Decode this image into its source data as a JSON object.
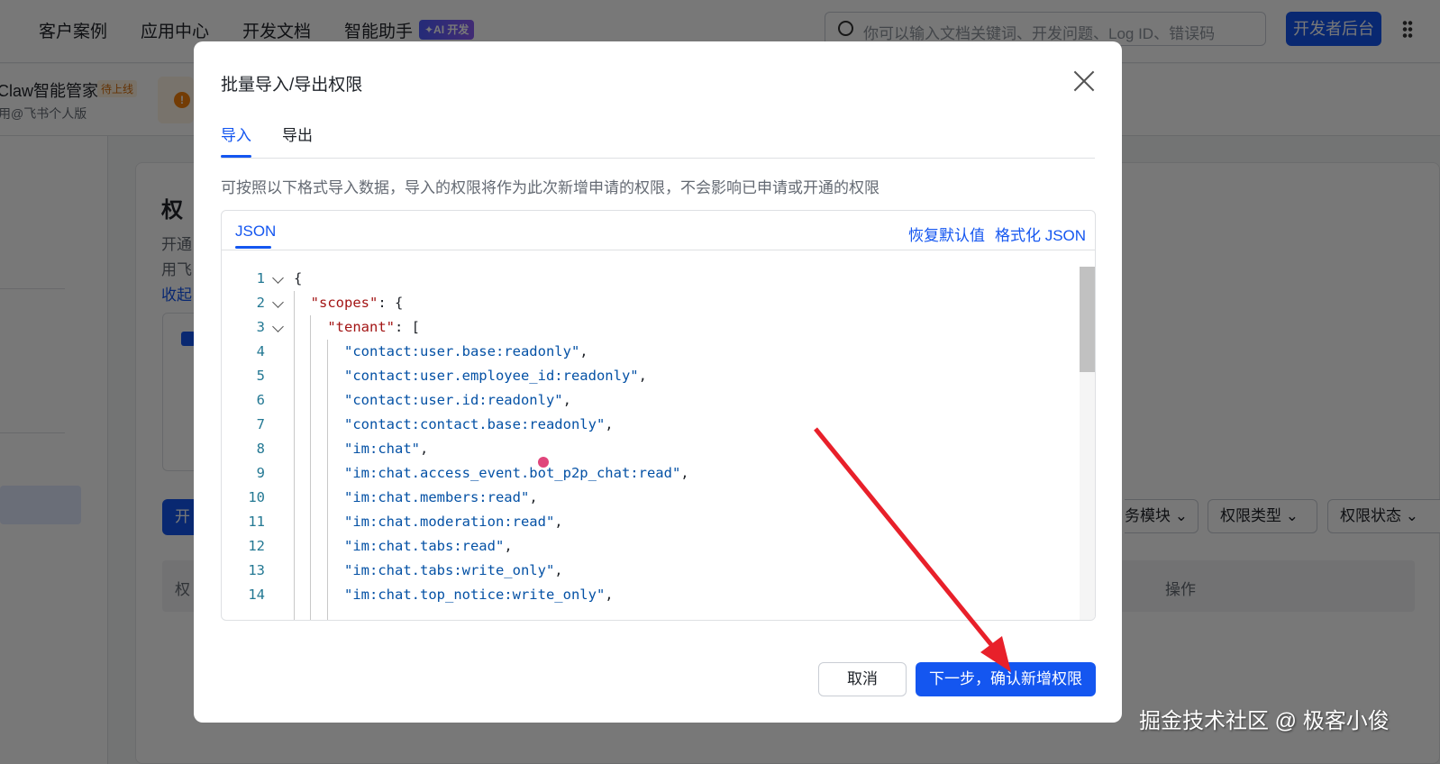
{
  "nav": {
    "items": [
      "客户案例",
      "应用中心",
      "开发文档",
      "智能助手"
    ],
    "ai_badge": "✦AI 开发",
    "search_placeholder": "你可以输入文档关键词、开发问题、Log ID、错误码",
    "dev_console": "开发者后台"
  },
  "app": {
    "name": "Claw智能管家",
    "status_badge": "待上线",
    "subtitle": "用@飞书个人版"
  },
  "background": {
    "title_fragment": "权",
    "desc_line1_fragment": "开通",
    "desc_line2_fragment": "用飞",
    "collapse_fragment": "收起",
    "button_fragment": "开",
    "table_header_fragment": "权",
    "filters": [
      "务模块",
      "权限类型",
      "权限状态"
    ],
    "table_action_header": "操作"
  },
  "modal": {
    "title": "批量导入/导出权限",
    "tabs": [
      "导入",
      "导出"
    ],
    "active_tab": "导入",
    "description": "可按照以下格式导入数据，导入的权限将作为此次新增申请的权限，不会影响已申请或开通的权限",
    "editor": {
      "tab": "JSON",
      "restore_default": "恢复默认值",
      "format_json": "格式化 JSON",
      "lines": [
        "{",
        "  \"scopes\": {",
        "    \"tenant\": [",
        "      \"contact:user.base:readonly\",",
        "      \"contact:user.employee_id:readonly\",",
        "      \"contact:user.id:readonly\",",
        "      \"contact:contact.base:readonly\",",
        "      \"im:chat\",",
        "      \"im:chat.access_event.bot_p2p_chat:read\",",
        "      \"im:chat.members:read\",",
        "      \"im:chat.moderation:read\",",
        "      \"im:chat.tabs:read\",",
        "      \"im:chat.tabs:write_only\",",
        "      \"im:chat.top_notice:write_only\","
      ]
    },
    "cancel": "取消",
    "next": "下一步，确认新增权限"
  },
  "watermark": "掘金技术社区 @ 极客小俊",
  "colors": {
    "primary": "#1456f0",
    "annotation_arrow": "#e8202a",
    "cursor_dot": "#e0457b"
  }
}
